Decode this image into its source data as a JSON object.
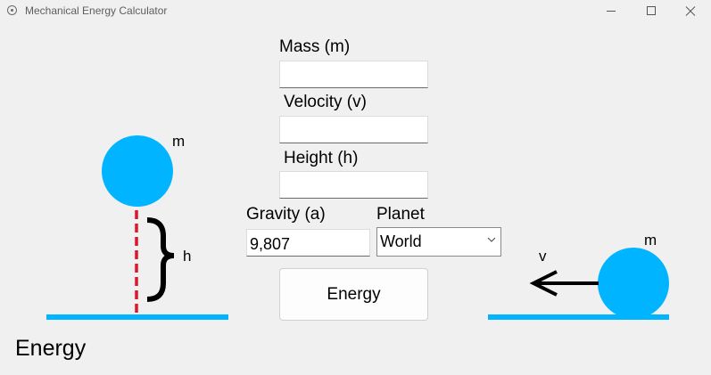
{
  "window": {
    "title": "Mechanical Energy Calculator"
  },
  "form": {
    "mass_label": "Mass (m)",
    "mass_value": "",
    "velocity_label": "Velocity (v)",
    "velocity_value": "",
    "height_label": "Height (h)",
    "height_value": "",
    "gravity_label": "Gravity (a)",
    "gravity_value": "9,807",
    "planet_label": "Planet",
    "planet_selected": "World",
    "energy_button": "Energy"
  },
  "result": {
    "text": "Energy"
  },
  "diagrams": {
    "potential": {
      "mass_label": "m",
      "height_label": "h"
    },
    "kinetic": {
      "mass_label": "m",
      "velocity_label": "v"
    }
  },
  "colors": {
    "ball": "#00b4ff",
    "ground": "#00b4ff",
    "height_line": "#e0142b"
  }
}
